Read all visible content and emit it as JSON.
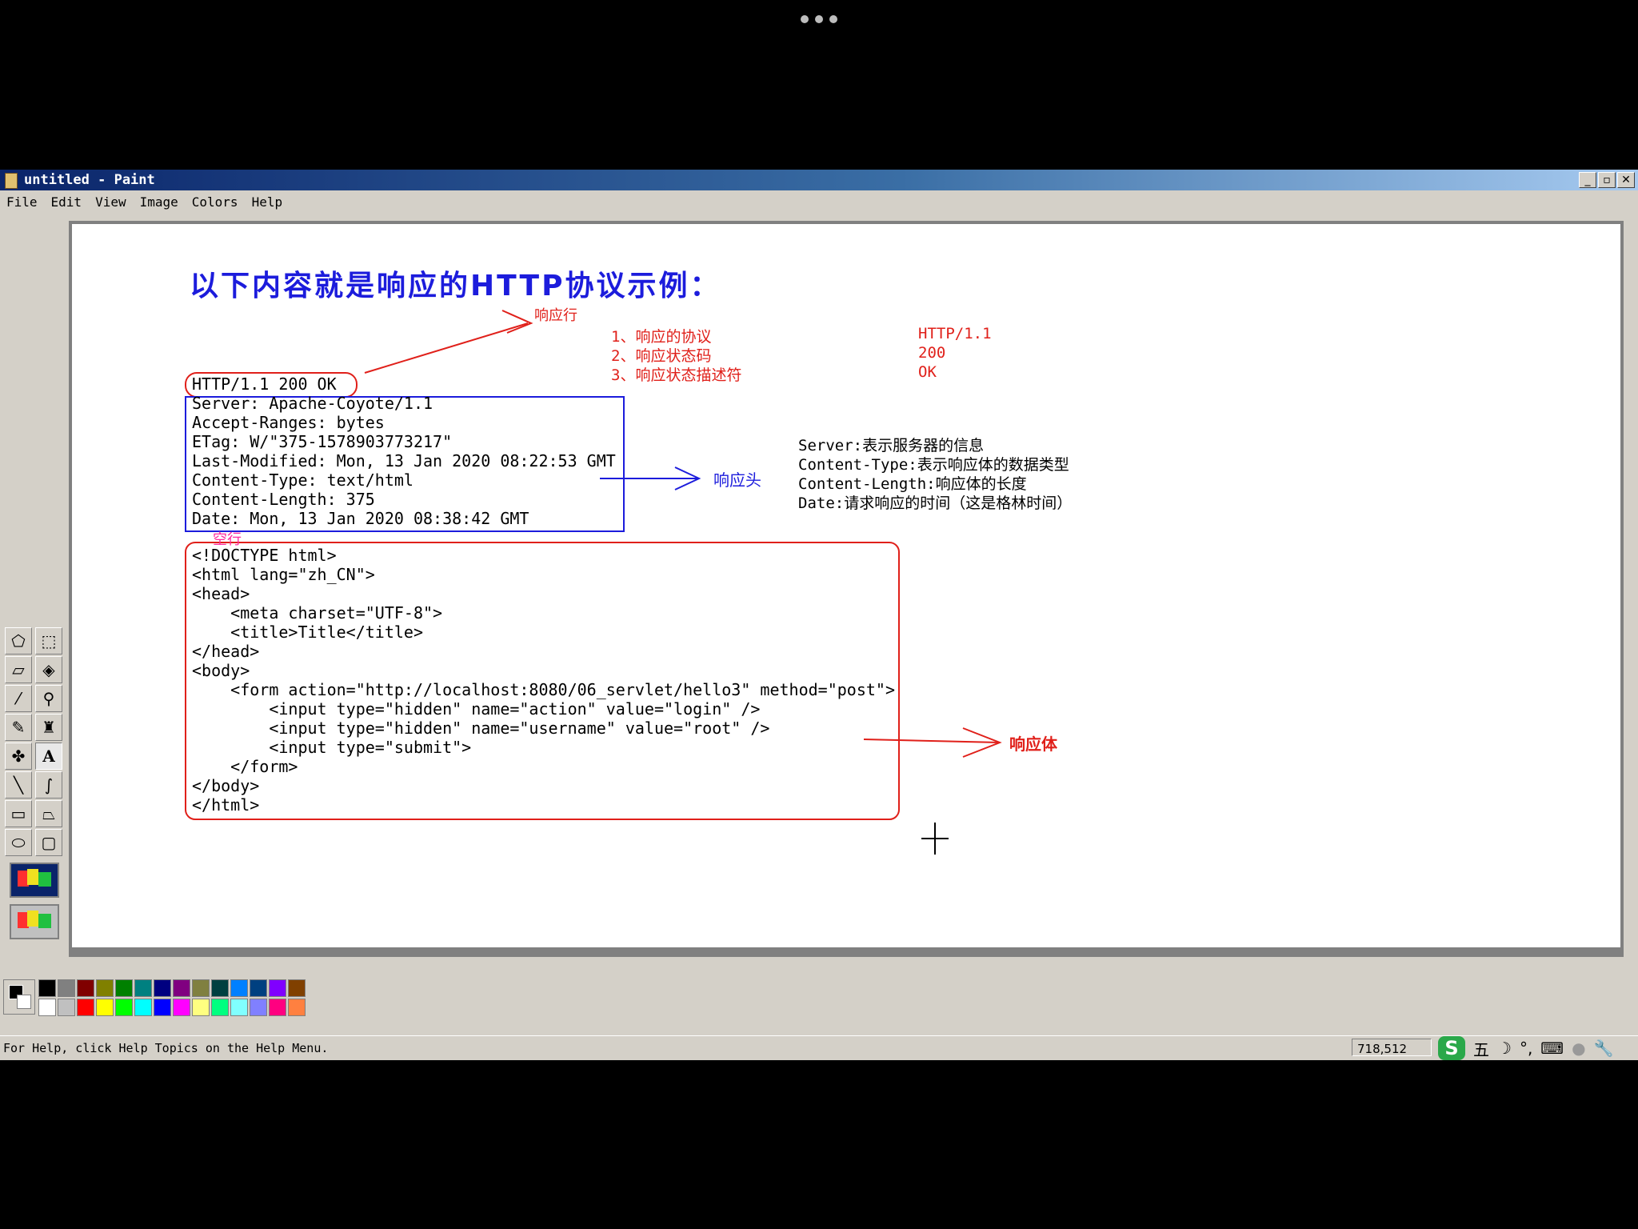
{
  "window": {
    "title": "untitled - Paint",
    "controls": {
      "minimize": "_",
      "restore": "▫",
      "close": "✕"
    }
  },
  "menu": [
    "File",
    "Edit",
    "View",
    "Image",
    "Colors",
    "Help"
  ],
  "canvas": {
    "heading": "以下内容就是响应的HTTP协议示例：",
    "status_line": "HTTP/1.1 200 OK",
    "status_line_note": "响应行",
    "status_explain": [
      {
        "label": "1、响应的协议",
        "value": "HTTP/1.1"
      },
      {
        "label": "2、响应状态码",
        "value": "200"
      },
      {
        "label": "3、响应状态描述符",
        "value": "OK"
      }
    ],
    "headers": [
      "Server: Apache-Coyote/1.1",
      "Accept-Ranges: bytes",
      "ETag: W/\"375-1578903773217\"",
      "Last-Modified: Mon, 13 Jan 2020 08:22:53 GMT",
      "Content-Type: text/html",
      "Content-Length: 375",
      "Date: Mon, 13 Jan 2020 08:38:42 GMT"
    ],
    "headers_note": "响应头",
    "header_explain": [
      "Server:表示服务器的信息",
      "Content-Type:表示响应体的数据类型",
      "Content-Length:响应体的长度",
      "Date:请求响应的时间（这是格林时间）"
    ],
    "blank_line_note": "空行",
    "body_lines": [
      "<!DOCTYPE html>",
      "<html lang=\"zh_CN\">",
      "<head>",
      "    <meta charset=\"UTF-8\">",
      "    <title>Title</title>",
      "</head>",
      "<body>",
      "    <form action=\"http://localhost:8080/06_servlet/hello3\" method=\"post\">",
      "        <input type=\"hidden\" name=\"action\" value=\"login\" />",
      "        <input type=\"hidden\" name=\"username\" value=\"root\" />",
      "        <input type=\"submit\">",
      "    </form>",
      "</body>",
      "</html>"
    ],
    "body_note": "响应体"
  },
  "tools": [
    "free-select-icon",
    "rect-select-icon",
    "eraser-icon",
    "fill-icon",
    "pick-color-icon",
    "magnifier-icon",
    "pencil-icon",
    "brush-icon",
    "airbrush-icon",
    "text-icon",
    "line-icon",
    "curve-icon",
    "rectangle-icon",
    "polygon-icon",
    "ellipse-icon",
    "rounded-rect-icon"
  ],
  "colors": {
    "accent_red": "#e0201a",
    "accent_blue": "#1c1cdc",
    "palette": [
      "#000000",
      "#808080",
      "#800000",
      "#808000",
      "#008000",
      "#008080",
      "#000080",
      "#800080",
      "#808040",
      "#004040",
      "#0080ff",
      "#004080",
      "#8000ff",
      "#804000",
      "#ffffff",
      "#c0c0c0",
      "#ff0000",
      "#ffff00",
      "#00ff00",
      "#00ffff",
      "#0000ff",
      "#ff00ff",
      "#ffff80",
      "#00ff80",
      "#80ffff",
      "#8080ff",
      "#ff0080",
      "#ff8040"
    ]
  },
  "status": {
    "message": "For Help, click Help Topics on the Help Menu.",
    "coords": "718,512",
    "ime_mode": "五"
  }
}
